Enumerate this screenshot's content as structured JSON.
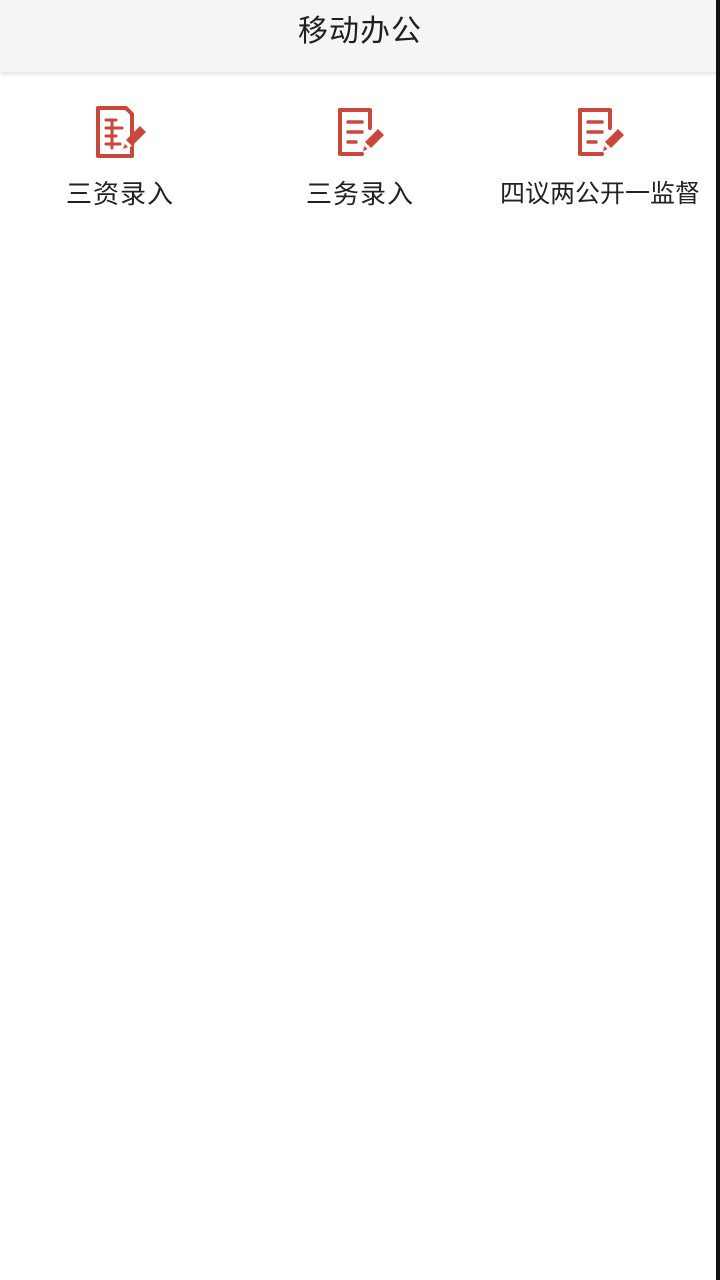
{
  "header": {
    "title": "移动办公"
  },
  "menu": {
    "items": [
      {
        "label": "三资录入",
        "icon": "edit-document-icon"
      },
      {
        "label": "三务录入",
        "icon": "document-pencil-icon"
      },
      {
        "label": "四议两公开一监督",
        "icon": "document-pencil-icon"
      }
    ]
  },
  "colors": {
    "accent": "#c8483b",
    "header_bg": "#f5f5f5",
    "background": "#ffffff"
  }
}
